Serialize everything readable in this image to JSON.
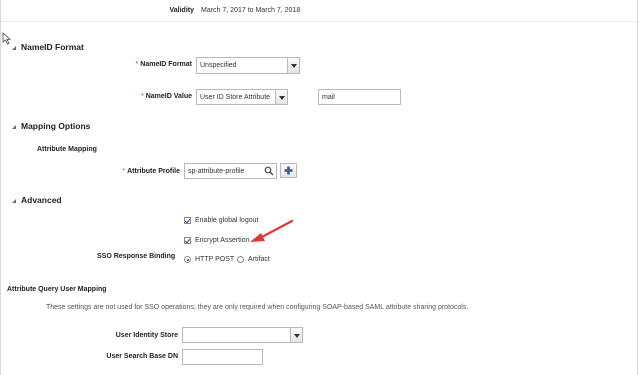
{
  "validity": {
    "label": "Validity",
    "value": "March 7, 2017 to March 7, 2018"
  },
  "nameid": {
    "section_title": "NameID Format",
    "format": {
      "required_mark": "*",
      "label": "NameID Format",
      "selected": "Unspecified"
    },
    "value": {
      "required_mark": "*",
      "label": "NameID Value",
      "selected": "User ID Store Attribute",
      "attribute": "mail"
    }
  },
  "mapping": {
    "section_title": "Mapping Options",
    "subheading": "Attribute Mapping",
    "profile": {
      "required_mark": "*",
      "label": "Attribute Profile",
      "value": "sp-attribute-profile"
    }
  },
  "advanced": {
    "section_title": "Advanced",
    "enable_global_logout": {
      "label": "Enable global logout",
      "checked": true
    },
    "encrypt_assertion": {
      "label": "Encrypt Assertion",
      "checked": true
    },
    "sso_binding": {
      "label": "SSO Response Binding",
      "options": [
        "HTTP POST",
        "Artifact"
      ],
      "selected": "HTTP POST"
    }
  },
  "attribute_query": {
    "title": "Attribute Query User Mapping",
    "note": "These settings are not used for SSO operations; they are only required when configuring SOAP-based SAML attribute sharing protocols.",
    "identity_store": {
      "label": "User Identity Store",
      "selected": ""
    },
    "search_base_dn": {
      "label": "User Search Base DN",
      "value": ""
    }
  },
  "colors": {
    "annotation_arrow": "#e03a3a",
    "required_mark": "#c0392b"
  },
  "icons": [
    "collapse-triangle-icon",
    "search-icon",
    "add-icon",
    "dropdown-arrow-icon",
    "annotation-arrow",
    "mouse-cursor-icon"
  ]
}
